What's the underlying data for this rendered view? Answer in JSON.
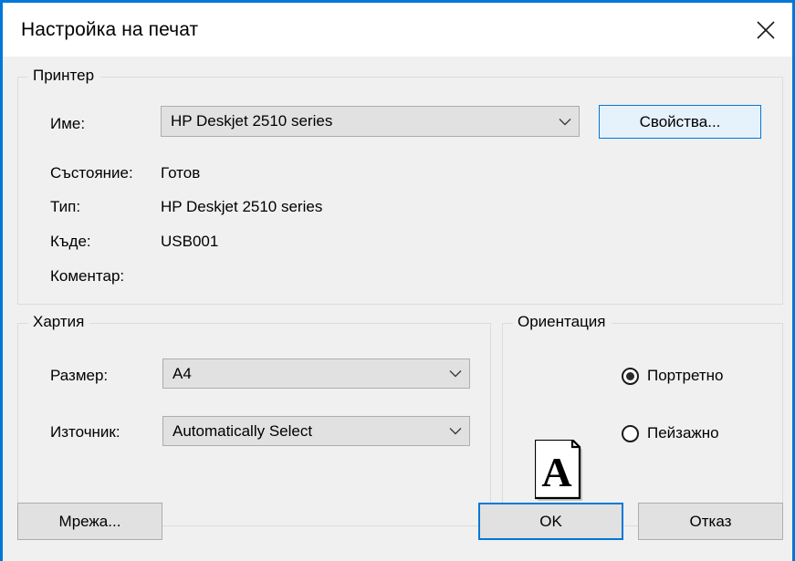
{
  "window": {
    "title": "Настройка на печат",
    "close_icon": "close-icon",
    "accent_color": "#0078d7",
    "titlebar_bg": "#ffffff",
    "client_bg": "#f0f0f0"
  },
  "printer": {
    "legend": "Принтер",
    "name_label": "Име:",
    "name_value": "HP Deskjet 2510 series",
    "name_dropdown_icon": "chevron-down-icon",
    "properties_button": "Свойства...",
    "status_label": "Състояние:",
    "status_value": "Готов",
    "type_label": "Тип:",
    "type_value": "HP Deskjet 2510 series",
    "where_label": "Къде:",
    "where_value": "USB001",
    "comment_label": "Коментар:",
    "comment_value": ""
  },
  "paper": {
    "legend": "Хартия",
    "size_label": "Размер:",
    "size_value": "A4",
    "size_dropdown_icon": "chevron-down-icon",
    "source_label": "Източник:",
    "source_value": "Automatically Select",
    "source_dropdown_icon": "chevron-down-icon"
  },
  "orientation": {
    "legend": "Ориентация",
    "preview_icon": "page-portrait-icon",
    "options": [
      {
        "label": "Портретно",
        "selected": true
      },
      {
        "label": "Пейзажно",
        "selected": false
      }
    ]
  },
  "footer": {
    "network_button": "Мрежа...",
    "ok_button": "OK",
    "cancel_button": "Отказ"
  }
}
